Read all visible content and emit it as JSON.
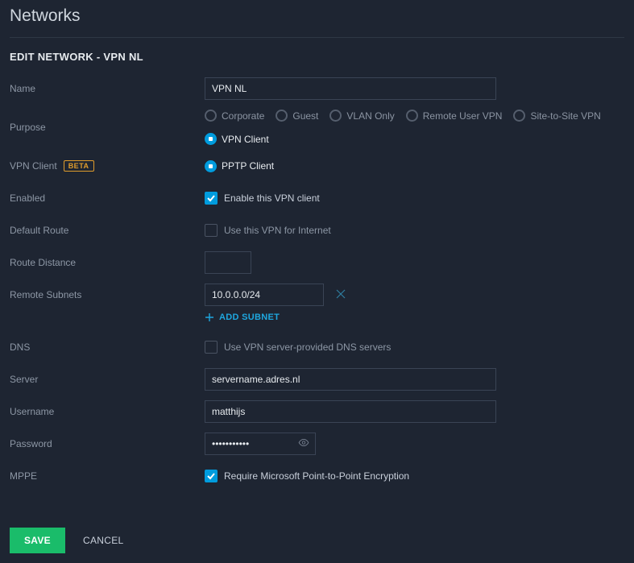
{
  "page": {
    "title": "Networks"
  },
  "panel": {
    "title": "EDIT NETWORK - VPN NL"
  },
  "labels": {
    "name": "Name",
    "purpose": "Purpose",
    "vpn_client": "VPN Client",
    "vpn_client_badge": "BETA",
    "enabled": "Enabled",
    "default_route": "Default Route",
    "route_distance": "Route Distance",
    "remote_subnets": "Remote Subnets",
    "dns": "DNS",
    "server": "Server",
    "username": "Username",
    "password": "Password",
    "mppe": "MPPE"
  },
  "values": {
    "name": "VPN NL",
    "route_distance": "",
    "remote_subnet": "10.0.0.0/24",
    "server": "servername.adres.nl",
    "username": "matthijs",
    "password_masked": "•••••••••••"
  },
  "purpose_options": {
    "corporate": "Corporate",
    "guest": "Guest",
    "vlan_only": "VLAN Only",
    "remote_user_vpn": "Remote User VPN",
    "site_to_site": "Site-to-Site VPN",
    "vpn_client": "VPN Client"
  },
  "vpn_client_type": {
    "pptp": "PPTP Client"
  },
  "checks": {
    "enable_vpn": "Enable this VPN client",
    "use_internet": "Use this VPN for Internet",
    "use_dns": "Use VPN server-provided DNS servers",
    "require_mppe": "Require Microsoft Point-to-Point Encryption"
  },
  "actions": {
    "add_subnet": "ADD SUBNET",
    "save": "SAVE",
    "cancel": "CANCEL"
  }
}
